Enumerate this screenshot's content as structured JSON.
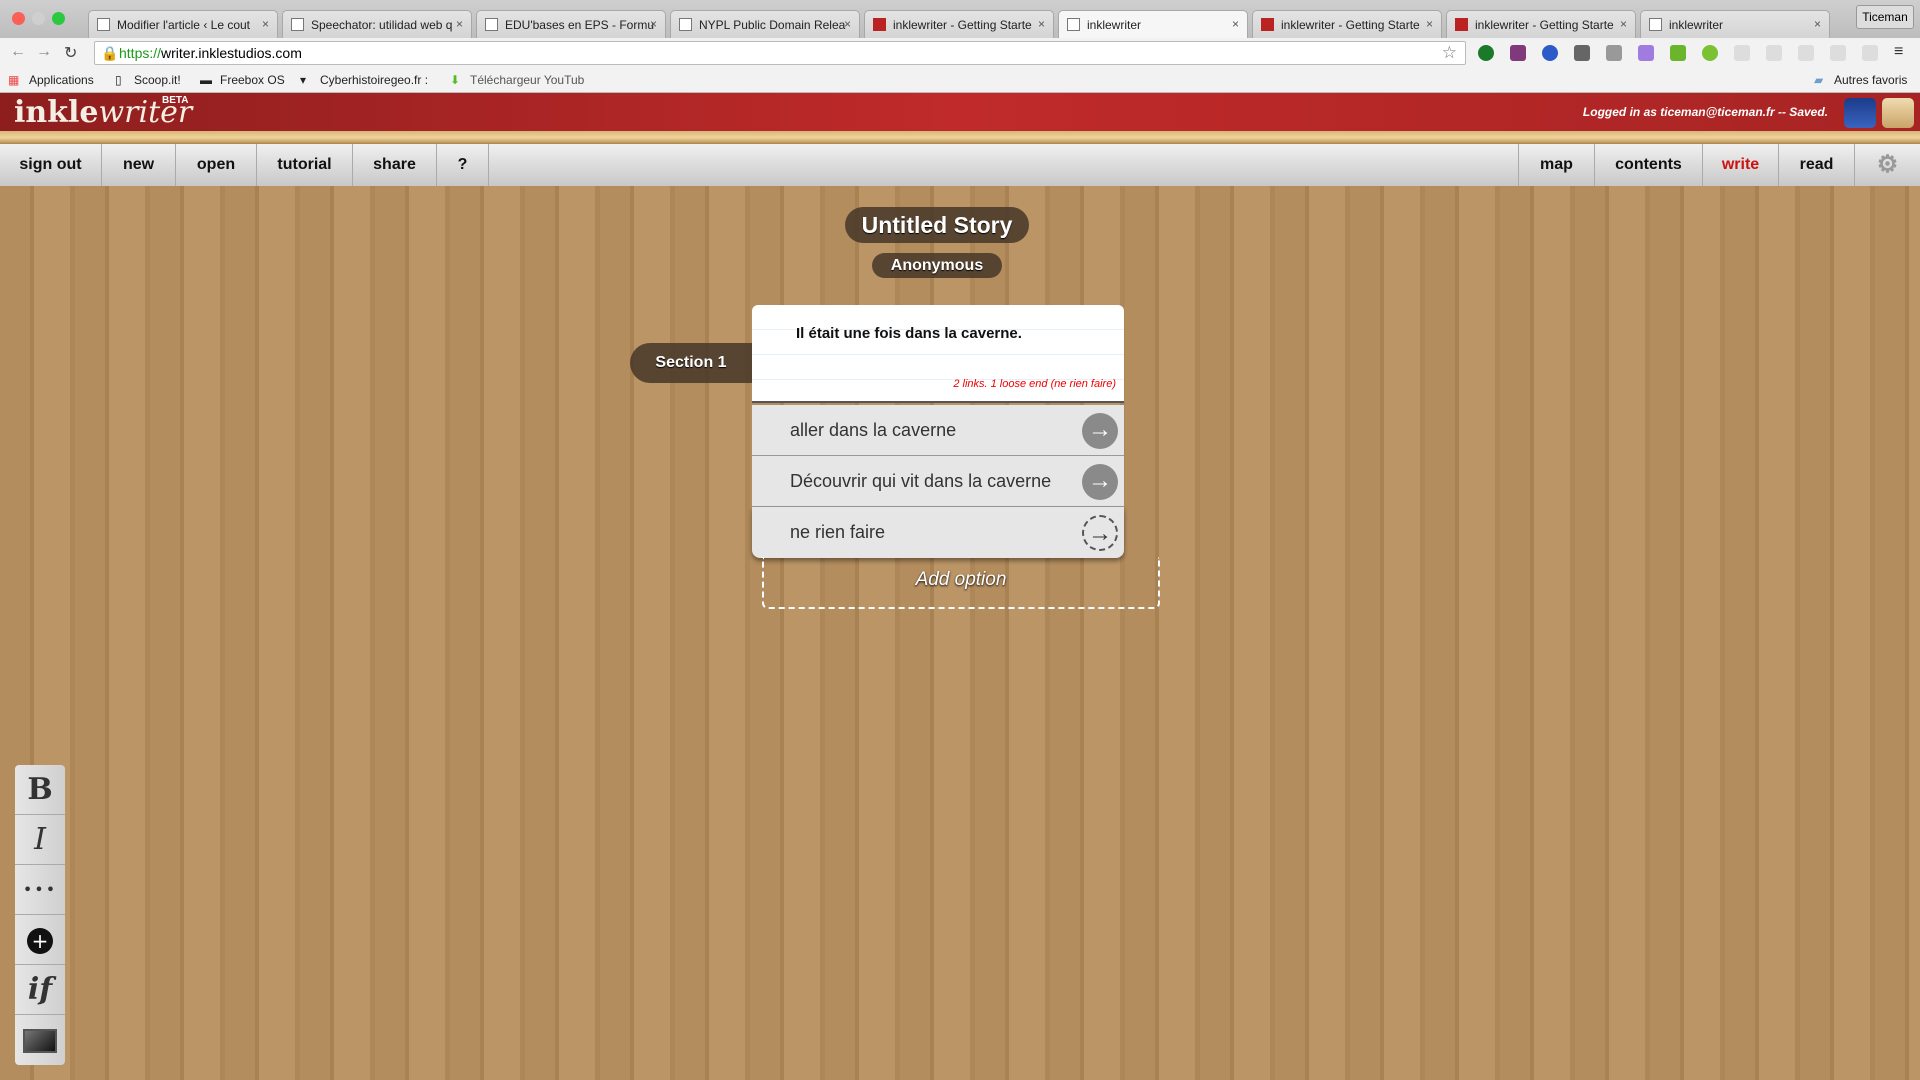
{
  "browser": {
    "tabs": [
      {
        "title": "Modifier l'article ‹ Le cout",
        "active": false,
        "favicon": "page-icon"
      },
      {
        "title": "Speechator: utilidad web q",
        "active": false,
        "favicon": "speechator-icon"
      },
      {
        "title": "EDU'bases en EPS - Formu",
        "active": false,
        "favicon": "edubases-icon"
      },
      {
        "title": "NYPL Public Domain Relea",
        "active": false,
        "favicon": "nypl-icon"
      },
      {
        "title": "inklewriter - Getting Starte",
        "active": false,
        "favicon": "inkle-icon"
      },
      {
        "title": "inklewriter",
        "active": true,
        "favicon": "page-icon"
      },
      {
        "title": "inklewriter - Getting Starte",
        "active": false,
        "favicon": "inkle-icon"
      },
      {
        "title": "inklewriter - Getting Starte",
        "active": false,
        "favicon": "inkle-icon"
      },
      {
        "title": "inklewriter",
        "active": false,
        "favicon": "page-icon"
      }
    ],
    "profile": "Ticeman",
    "url_scheme": "https://",
    "url_rest": "writer.inklestudios.com",
    "bookmarks": [
      "Applications",
      "Scoop.it!",
      "Freebox OS",
      "Cyberhistoiregeo.fr :",
      "Téléchargeur YouTub"
    ],
    "other_bookmarks": "Autres favoris"
  },
  "app": {
    "logo": "inklewriter",
    "logo_bold": "inkle",
    "logo_italic": "writer",
    "beta": "BETA",
    "status": "Logged in as ticeman@ticeman.fr -- Saved.",
    "nav_left": [
      "sign out",
      "new",
      "open",
      "tutorial",
      "share",
      "?"
    ],
    "nav_right": [
      "map",
      "contents",
      "write",
      "read"
    ],
    "active_nav": "write",
    "accent": "#cc1111"
  },
  "story": {
    "title": "Untitled Story",
    "author": "Anonymous",
    "section": "Section 1",
    "text": "Il était une fois dans la caverne.",
    "status": "2 links. 1 loose end (ne rien faire)",
    "options": [
      {
        "label": "aller dans la caverne",
        "linked": true
      },
      {
        "label": "Découvrir qui vit dans la caverne",
        "linked": true
      },
      {
        "label": "ne rien faire",
        "linked": false
      }
    ],
    "add_option": "Add option"
  },
  "toolbar": {
    "bold": "B",
    "italic": "I",
    "ellipsis": "•••",
    "if": "if"
  }
}
